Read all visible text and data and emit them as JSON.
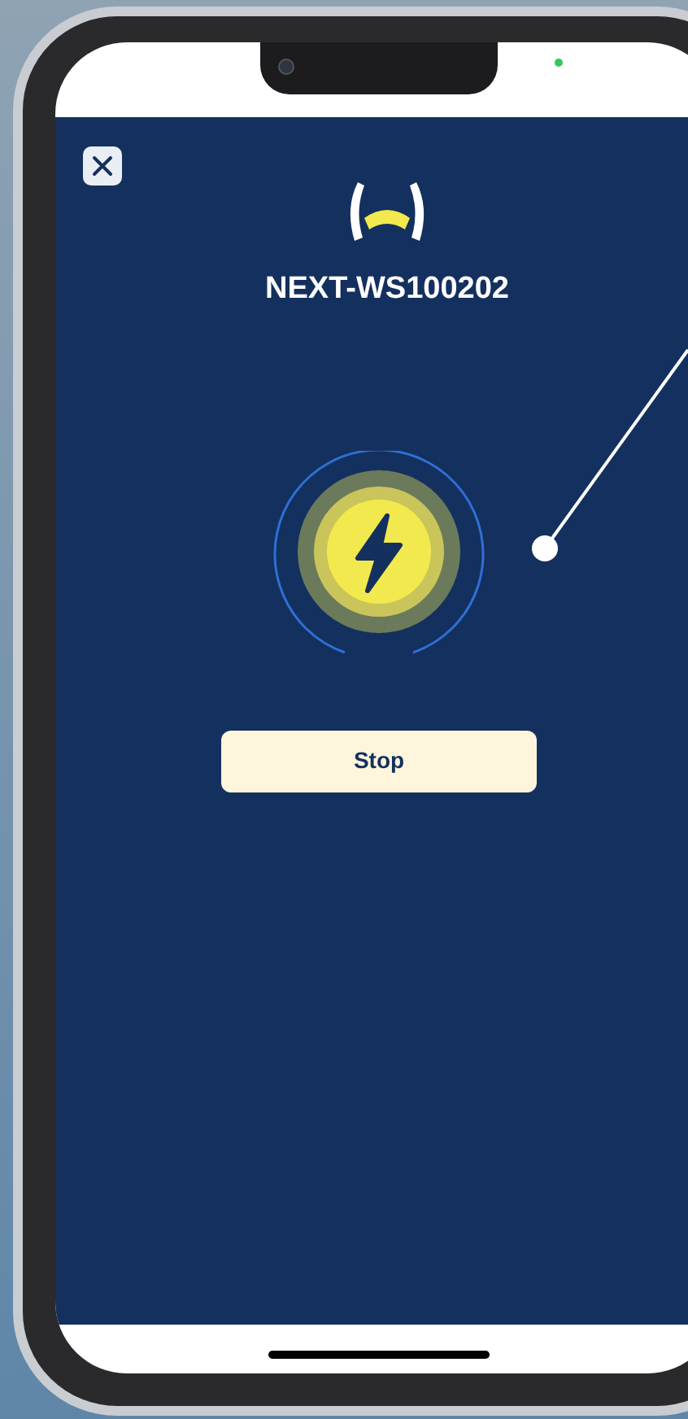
{
  "device": {
    "name": "NEXT-WS100202"
  },
  "actions": [
    {
      "label": "Stop"
    }
  ]
}
